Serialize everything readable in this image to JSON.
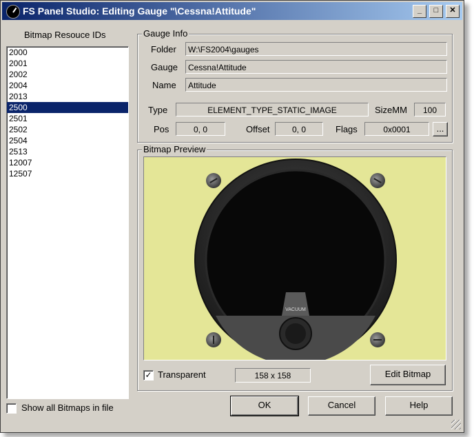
{
  "window": {
    "title": "FS Panel Studio: Editing Gauge \"\\Cessna!Attitude\"",
    "controls": [
      "_",
      "□",
      "✕"
    ]
  },
  "left": {
    "header": "Bitmap Resouce IDs",
    "items": [
      "2000",
      "2001",
      "2002",
      "2004",
      "2013",
      "2500",
      "2501",
      "2502",
      "2504",
      "2513",
      "12007",
      "12507"
    ],
    "selected_index": 5,
    "show_all_label": "Show all Bitmaps in file",
    "show_all_checked": false
  },
  "gauge_info": {
    "title": "Gauge Info",
    "folder_label": "Folder",
    "folder_value": "W:\\FS2004\\gauges",
    "gauge_label": "Gauge",
    "gauge_value": "Cessna!Attitude",
    "name_label": "Name",
    "name_value": "Attitude",
    "type_label": "Type",
    "type_value": "ELEMENT_TYPE_STATIC_IMAGE",
    "sizemm_label": "SizeMM",
    "sizemm_value": "100",
    "pos_label": "Pos",
    "pos_value": "0, 0",
    "offset_label": "Offset",
    "offset_value": "0, 0",
    "flags_label": "Flags",
    "flags_value": "0x0001",
    "flags_button": "..."
  },
  "bitmap_preview": {
    "title": "Bitmap Preview",
    "bg_color": "#e4e697",
    "gauge_text": "VACUUM",
    "transparent_label": "Transparent",
    "transparent_checked": true,
    "checkmark": "✓",
    "size_value": "158 x 158",
    "edit_button": "Edit Bitmap"
  },
  "footer": {
    "ok": "OK",
    "cancel": "Cancel",
    "help": "Help"
  }
}
